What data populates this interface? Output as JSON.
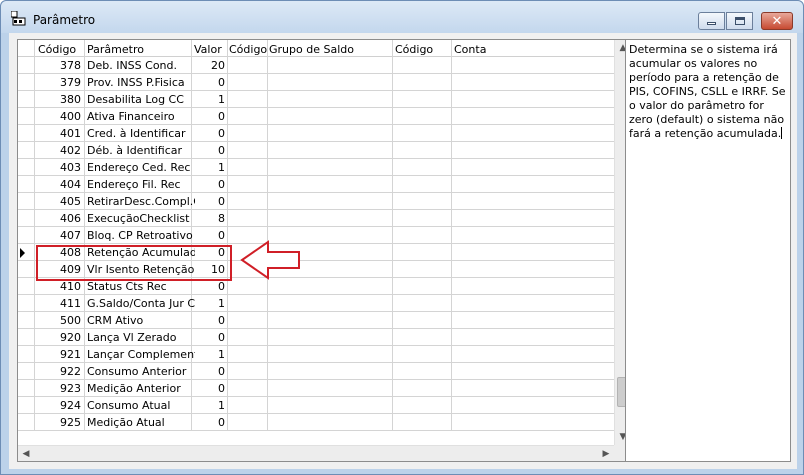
{
  "window": {
    "title": "Parâmetro"
  },
  "grid": {
    "columns": [
      "Código",
      "Parâmetro",
      "Valor",
      "Código",
      "Grupo de Saldo",
      "Código",
      "Conta"
    ],
    "rows": [
      {
        "codigo": "378",
        "parametro": "Deb. INSS Cond.",
        "valor": "20"
      },
      {
        "codigo": "379",
        "parametro": "Prov. INSS P.Fisica",
        "valor": "0"
      },
      {
        "codigo": "380",
        "parametro": "Desabilita Log CC",
        "valor": "1"
      },
      {
        "codigo": "400",
        "parametro": "Ativa Financeiro",
        "valor": "0"
      },
      {
        "codigo": "401",
        "parametro": "Cred. à Identificar",
        "valor": "0"
      },
      {
        "codigo": "402",
        "parametro": "Déb. à Identificar",
        "valor": "0"
      },
      {
        "codigo": "403",
        "parametro": "Endereço Ced. Rec",
        "valor": "1"
      },
      {
        "codigo": "404",
        "parametro": "Endereço Fil. Rec",
        "valor": "0"
      },
      {
        "codigo": "405",
        "parametro": "RetirarDesc.Compl.CP",
        "valor": "0"
      },
      {
        "codigo": "406",
        "parametro": "ExecuçãoChecklist",
        "valor": "8"
      },
      {
        "codigo": "407",
        "parametro": "Bloq. CP Retroativo",
        "valor": "0"
      },
      {
        "codigo": "408",
        "parametro": "Retenção Acumulada",
        "valor": "0"
      },
      {
        "codigo": "409",
        "parametro": "Vlr Isento Retenção",
        "valor": "10"
      },
      {
        "codigo": "410",
        "parametro": "Status Cts Rec",
        "valor": "0"
      },
      {
        "codigo": "411",
        "parametro": "G.Saldo/Conta Jur C",
        "valor": "1"
      },
      {
        "codigo": "500",
        "parametro": "CRM Ativo",
        "valor": "0"
      },
      {
        "codigo": "920",
        "parametro": "Lança Vl Zerado",
        "valor": "0"
      },
      {
        "codigo": "921",
        "parametro": "Lançar Complemento",
        "valor": "1"
      },
      {
        "codigo": "922",
        "parametro": "Consumo Anterior",
        "valor": "0"
      },
      {
        "codigo": "923",
        "parametro": "Medição Anterior",
        "valor": "0"
      },
      {
        "codigo": "924",
        "parametro": "Consumo Atual",
        "valor": "1"
      },
      {
        "codigo": "925",
        "parametro": "Medição Atual",
        "valor": "0"
      }
    ],
    "current_row_index": 11
  },
  "description": {
    "text": "Determina se o sistema irá acumular os valores no período para a retenção de PIS, COFINS, CSLL e IRRF. Se o valor do parâmetro for zero (default) o sistema não fará a retenção acumulada."
  },
  "icons": {
    "app": "app-icon",
    "minimize": "minimize-icon",
    "maximize": "maximize-icon",
    "close": "close-icon",
    "row_pointer": "row-pointer-icon",
    "annotation_arrow": "annotation-arrow"
  },
  "colors": {
    "annotation": "#d01f27",
    "close_button": "#c74a31"
  }
}
